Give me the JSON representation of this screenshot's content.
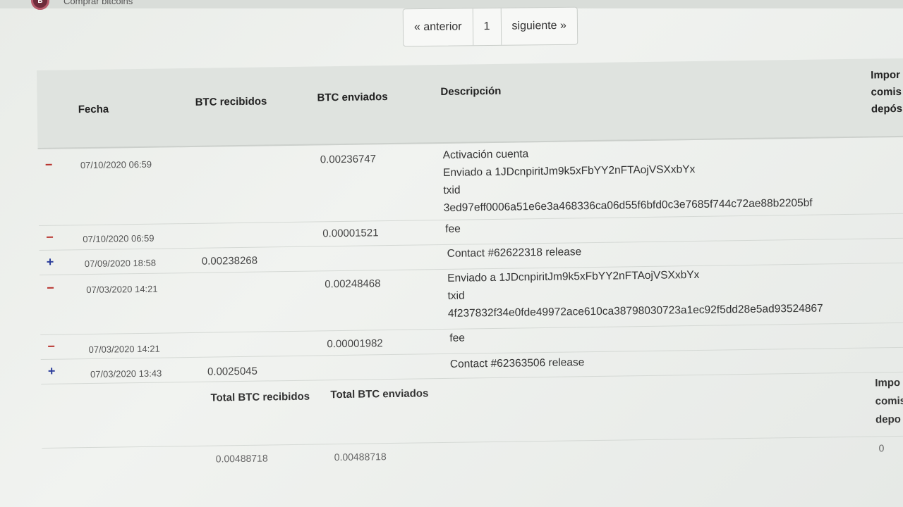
{
  "brand": {
    "icon": "bitcoin-shield-icon",
    "icon_text": "B",
    "label": "Comprar bitcoins"
  },
  "pagination": {
    "prev": "« anterior",
    "page": "1",
    "next": "siguiente »"
  },
  "table": {
    "headers": {
      "fecha": "Fecha",
      "recibidos": "BTC recibidos",
      "enviados": "BTC enviados",
      "descripcion": "Descripción",
      "importe_comision": "Impor comis depós"
    },
    "rows": [
      {
        "sign": "−",
        "type": "minus",
        "date": "07/10/2020 06:59",
        "received": "",
        "sent": "0.00236747",
        "desc": [
          "Activación cuenta",
          "Enviado a 1JDcnpiritJm9k5xFbYY2nFTAojVSXxbYx",
          "txid",
          "3ed97eff0006a51e6e3a468336ca06d55f6bfd0c3e7685f744c72ae88b2205bf"
        ]
      },
      {
        "sign": "−",
        "type": "minus",
        "date": "07/10/2020 06:59",
        "received": "",
        "sent": "0.00001521",
        "desc": [
          "fee"
        ]
      },
      {
        "sign": "+",
        "type": "plus",
        "date": "07/09/2020 18:58",
        "received": "0.00238268",
        "sent": "",
        "desc": [
          "Contact #62622318 release"
        ]
      },
      {
        "sign": "−",
        "type": "minus",
        "date": "07/03/2020 14:21",
        "received": "",
        "sent": "0.00248468",
        "desc": [
          "Enviado a 1JDcnpiritJm9k5xFbYY2nFTAojVSXxbYx",
          "txid",
          "4f237832f34e0fde49972ace610ca38798030723a1ec92f5dd28e5ad93524867"
        ]
      },
      {
        "sign": "−",
        "type": "minus",
        "date": "07/03/2020 14:21",
        "received": "",
        "sent": "0.00001982",
        "desc": [
          "fee"
        ]
      },
      {
        "sign": "+",
        "type": "plus",
        "date": "07/03/2020 13:43",
        "received": "0.0025045",
        "sent": "",
        "desc": [
          "Contact #62363506 release"
        ]
      }
    ],
    "totals": {
      "received_label": "Total BTC recibidos",
      "sent_label": "Total BTC enviados",
      "commission_label": "Impo comis depo",
      "received_value": "0.00488718",
      "sent_value": "0.00488718",
      "commission_value": "0"
    }
  },
  "colors": {
    "minus": "#b8332e",
    "plus": "#2b3d9b",
    "header_bg": "#dfe3df"
  },
  "cursor_icon": "mouse-pointer-icon"
}
